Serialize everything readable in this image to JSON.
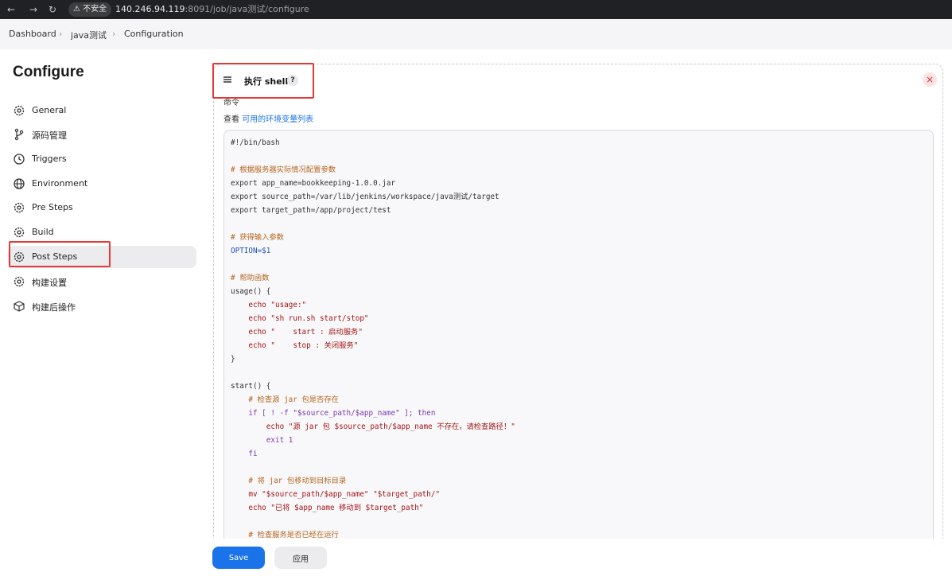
{
  "browser": {
    "back_icon": "←",
    "forward_icon": "→",
    "reload_icon": "↻",
    "security_label": "⚠ 不安全",
    "url_host": "140.246.94.119",
    "url_rest": ":8091/job/java测试/configure"
  },
  "breadcrumb": {
    "items": [
      "Dashboard",
      "java测试",
      "Configuration"
    ],
    "separator": "›"
  },
  "page": {
    "title": "Configure"
  },
  "sidebar": {
    "items": [
      {
        "label": "General",
        "icon": "gear-icon"
      },
      {
        "label": "源码管理",
        "icon": "branch-icon"
      },
      {
        "label": "Triggers",
        "icon": "clock-icon"
      },
      {
        "label": "Environment",
        "icon": "globe-icon"
      },
      {
        "label": "Pre Steps",
        "icon": "gear-icon"
      },
      {
        "label": "Build",
        "icon": "gear-icon"
      },
      {
        "label": "Post Steps",
        "icon": "gear-icon",
        "active": true
      },
      {
        "label": "构建设置",
        "icon": "gear-icon"
      },
      {
        "label": "构建后操作",
        "icon": "box-icon"
      }
    ]
  },
  "step": {
    "handle_icon": "≡",
    "title": "执行 shell",
    "help": "?",
    "close": "×",
    "command_label": "命令",
    "env_prefix": "查看",
    "env_link": "可用的环境变量列表"
  },
  "code": {
    "lines": [
      "#!/bin/bash",
      "",
      "# 根据服务器实际情况配置参数",
      "export app_name=bookkeeping-1.0.0.jar",
      "export source_path=/var/lib/jenkins/workspace/java测试/target",
      "export target_path=/app/project/test",
      "",
      "# 获得输入参数",
      "OPTION=$1",
      "",
      "# 帮助函数",
      "usage() {",
      "    echo \"usage:\"",
      "    echo \"sh run.sh start/stop\"",
      "    echo \"    start : 启动服务\"",
      "    echo \"    stop : 关闭服务\"",
      "}",
      "",
      "start() {",
      "    # 检查源 jar 包是否存在",
      "    if [ ! -f \"$source_path/$app_name\" ]; then",
      "        echo \"源 jar 包 $source_path/$app_name 不存在，请检查路径！\"",
      "        exit 1",
      "    fi",
      "",
      "    # 将 jar 包移动到目标目录",
      "    mv \"$source_path/$app_name\" \"$target_path/\"",
      "    echo \"已将 $app_name 移动到 $target_path\"",
      "",
      "    # 检查服务是否已经在运行"
    ]
  },
  "actions": {
    "save_label": "Save",
    "apply_label": "应用"
  },
  "colors": {
    "accent": "#1a73e8",
    "highlight": "#e53935",
    "close": "#d32f2f"
  }
}
